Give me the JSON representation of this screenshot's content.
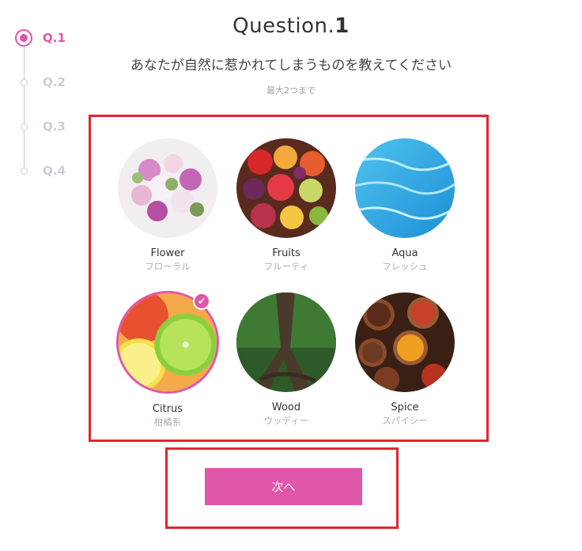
{
  "stepper": {
    "steps": [
      {
        "label": "Q.1",
        "active": true
      },
      {
        "label": "Q.2",
        "active": false
      },
      {
        "label": "Q.3",
        "active": false
      },
      {
        "label": "Q.4",
        "active": false
      }
    ]
  },
  "question": {
    "title_prefix": "Question.",
    "title_number": "1",
    "text": "あなたが自然に惹かれてしまうものを教えてください",
    "hint": "最大2つまで"
  },
  "options": [
    {
      "name": "Flower",
      "jp": "フローラル",
      "selected": false,
      "icon": "flower-bouquet-image"
    },
    {
      "name": "Fruits",
      "jp": "フルーティ",
      "selected": false,
      "icon": "fruits-image"
    },
    {
      "name": "Aqua",
      "jp": "フレッシュ",
      "selected": false,
      "icon": "water-image"
    },
    {
      "name": "Citrus",
      "jp": "柑橘系",
      "selected": true,
      "icon": "citrus-image"
    },
    {
      "name": "Wood",
      "jp": "ウッディー",
      "selected": false,
      "icon": "tree-roots-image"
    },
    {
      "name": "Spice",
      "jp": "スパイシー",
      "selected": false,
      "icon": "spices-image"
    }
  ],
  "next_button": {
    "label": "次へ"
  },
  "colors": {
    "accent": "#e056a8",
    "highlight_frame": "#e52431",
    "inactive": "#c9ced6"
  }
}
